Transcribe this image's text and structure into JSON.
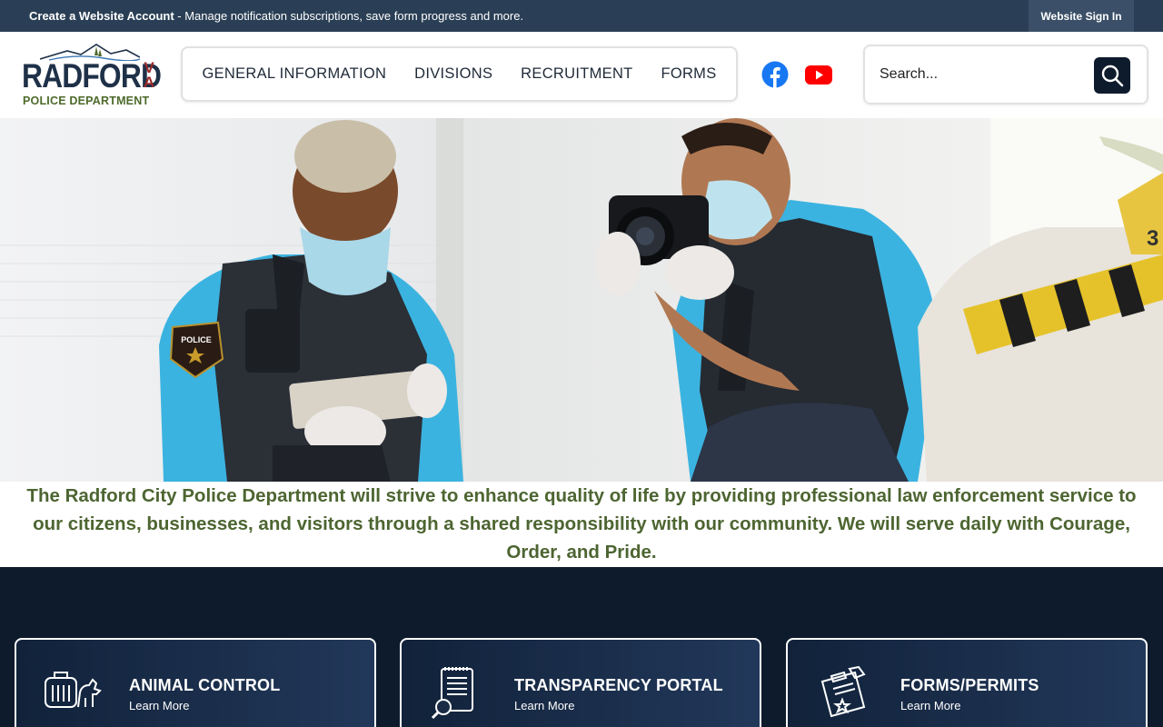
{
  "topbar": {
    "create_bold": "Create a Website Account",
    "create_rest": " - Manage notification subscriptions, save form progress and more.",
    "signin": "Website Sign In"
  },
  "logo": {
    "name": "RADFORD",
    "state_v": "V",
    "state_a": "A",
    "dept": "POLICE DEPARTMENT"
  },
  "nav": {
    "items": [
      "GENERAL INFORMATION",
      "DIVISIONS",
      "RECRUITMENT",
      "FORMS"
    ]
  },
  "social": {
    "facebook_icon": "facebook-icon",
    "youtube_icon": "youtube-icon"
  },
  "search": {
    "placeholder": "Search..."
  },
  "hero": {
    "badge": "POLICE",
    "marker": "3"
  },
  "mission": {
    "text": "The Radford City Police Department will strive to enhance quality of life by providing professional law enforcement service to our citizens, businesses, and visitors through a shared responsibility with our community. We will serve daily with Courage, Order, and Pride."
  },
  "cards": [
    {
      "title": "ANIMAL CONTROL",
      "sub": "Learn More",
      "icon": "animal-carrier-icon"
    },
    {
      "title": "TRANSPARENCY PORTAL",
      "sub": "Learn More",
      "icon": "document-search-icon"
    },
    {
      "title": "FORMS/PERMITS",
      "sub": "Learn More",
      "icon": "clipboard-badge-icon"
    }
  ],
  "colors": {
    "navy": "#0e1b2c",
    "topbar": "#2a3f55",
    "mission_green": "#4d6531",
    "logo_red": "#9a2a2a"
  }
}
